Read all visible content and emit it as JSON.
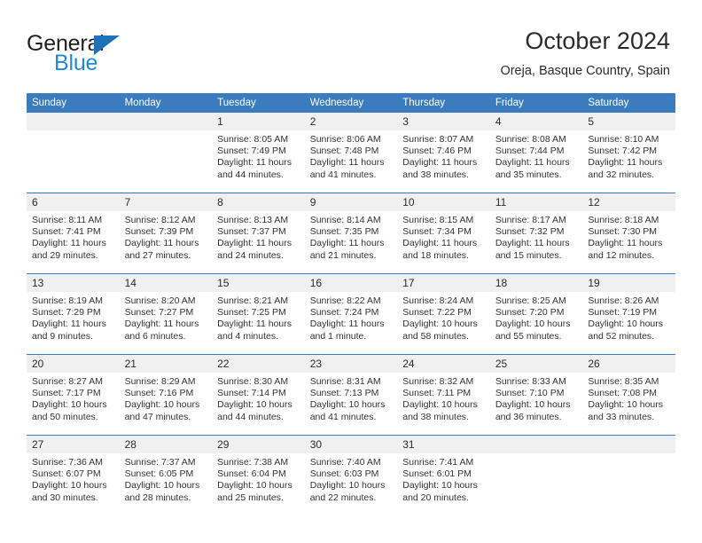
{
  "brand": {
    "name_part1": "General",
    "name_part2": "Blue",
    "triangle_color": "#1f72b8",
    "blue_color": "#1f8ad6"
  },
  "header": {
    "title": "October 2024",
    "subtitle": "Oreja, Basque Country, Spain"
  },
  "theme": {
    "header_blue": "#3a7cbe",
    "daynum_band": "#f0f0f0"
  },
  "weekdays": [
    "Sunday",
    "Monday",
    "Tuesday",
    "Wednesday",
    "Thursday",
    "Friday",
    "Saturday"
  ],
  "labels": {
    "sunrise_prefix": "Sunrise:",
    "sunset_prefix": "Sunset:",
    "daylight_prefix": "Daylight:"
  },
  "weeks": [
    [
      {
        "day": "",
        "sunrise": "",
        "sunset": "",
        "daylight": "",
        "blank": true
      },
      {
        "day": "",
        "sunrise": "",
        "sunset": "",
        "daylight": "",
        "blank": true
      },
      {
        "day": "1",
        "sunrise": "Sunrise: 8:05 AM",
        "sunset": "Sunset: 7:49 PM",
        "daylight": "Daylight: 11 hours and 44 minutes."
      },
      {
        "day": "2",
        "sunrise": "Sunrise: 8:06 AM",
        "sunset": "Sunset: 7:48 PM",
        "daylight": "Daylight: 11 hours and 41 minutes."
      },
      {
        "day": "3",
        "sunrise": "Sunrise: 8:07 AM",
        "sunset": "Sunset: 7:46 PM",
        "daylight": "Daylight: 11 hours and 38 minutes."
      },
      {
        "day": "4",
        "sunrise": "Sunrise: 8:08 AM",
        "sunset": "Sunset: 7:44 PM",
        "daylight": "Daylight: 11 hours and 35 minutes."
      },
      {
        "day": "5",
        "sunrise": "Sunrise: 8:10 AM",
        "sunset": "Sunset: 7:42 PM",
        "daylight": "Daylight: 11 hours and 32 minutes."
      }
    ],
    [
      {
        "day": "6",
        "sunrise": "Sunrise: 8:11 AM",
        "sunset": "Sunset: 7:41 PM",
        "daylight": "Daylight: 11 hours and 29 minutes."
      },
      {
        "day": "7",
        "sunrise": "Sunrise: 8:12 AM",
        "sunset": "Sunset: 7:39 PM",
        "daylight": "Daylight: 11 hours and 27 minutes."
      },
      {
        "day": "8",
        "sunrise": "Sunrise: 8:13 AM",
        "sunset": "Sunset: 7:37 PM",
        "daylight": "Daylight: 11 hours and 24 minutes."
      },
      {
        "day": "9",
        "sunrise": "Sunrise: 8:14 AM",
        "sunset": "Sunset: 7:35 PM",
        "daylight": "Daylight: 11 hours and 21 minutes."
      },
      {
        "day": "10",
        "sunrise": "Sunrise: 8:15 AM",
        "sunset": "Sunset: 7:34 PM",
        "daylight": "Daylight: 11 hours and 18 minutes."
      },
      {
        "day": "11",
        "sunrise": "Sunrise: 8:17 AM",
        "sunset": "Sunset: 7:32 PM",
        "daylight": "Daylight: 11 hours and 15 minutes."
      },
      {
        "day": "12",
        "sunrise": "Sunrise: 8:18 AM",
        "sunset": "Sunset: 7:30 PM",
        "daylight": "Daylight: 11 hours and 12 minutes."
      }
    ],
    [
      {
        "day": "13",
        "sunrise": "Sunrise: 8:19 AM",
        "sunset": "Sunset: 7:29 PM",
        "daylight": "Daylight: 11 hours and 9 minutes."
      },
      {
        "day": "14",
        "sunrise": "Sunrise: 8:20 AM",
        "sunset": "Sunset: 7:27 PM",
        "daylight": "Daylight: 11 hours and 6 minutes."
      },
      {
        "day": "15",
        "sunrise": "Sunrise: 8:21 AM",
        "sunset": "Sunset: 7:25 PM",
        "daylight": "Daylight: 11 hours and 4 minutes."
      },
      {
        "day": "16",
        "sunrise": "Sunrise: 8:22 AM",
        "sunset": "Sunset: 7:24 PM",
        "daylight": "Daylight: 11 hours and 1 minute."
      },
      {
        "day": "17",
        "sunrise": "Sunrise: 8:24 AM",
        "sunset": "Sunset: 7:22 PM",
        "daylight": "Daylight: 10 hours and 58 minutes."
      },
      {
        "day": "18",
        "sunrise": "Sunrise: 8:25 AM",
        "sunset": "Sunset: 7:20 PM",
        "daylight": "Daylight: 10 hours and 55 minutes."
      },
      {
        "day": "19",
        "sunrise": "Sunrise: 8:26 AM",
        "sunset": "Sunset: 7:19 PM",
        "daylight": "Daylight: 10 hours and 52 minutes."
      }
    ],
    [
      {
        "day": "20",
        "sunrise": "Sunrise: 8:27 AM",
        "sunset": "Sunset: 7:17 PM",
        "daylight": "Daylight: 10 hours and 50 minutes."
      },
      {
        "day": "21",
        "sunrise": "Sunrise: 8:29 AM",
        "sunset": "Sunset: 7:16 PM",
        "daylight": "Daylight: 10 hours and 47 minutes."
      },
      {
        "day": "22",
        "sunrise": "Sunrise: 8:30 AM",
        "sunset": "Sunset: 7:14 PM",
        "daylight": "Daylight: 10 hours and 44 minutes."
      },
      {
        "day": "23",
        "sunrise": "Sunrise: 8:31 AM",
        "sunset": "Sunset: 7:13 PM",
        "daylight": "Daylight: 10 hours and 41 minutes."
      },
      {
        "day": "24",
        "sunrise": "Sunrise: 8:32 AM",
        "sunset": "Sunset: 7:11 PM",
        "daylight": "Daylight: 10 hours and 38 minutes."
      },
      {
        "day": "25",
        "sunrise": "Sunrise: 8:33 AM",
        "sunset": "Sunset: 7:10 PM",
        "daylight": "Daylight: 10 hours and 36 minutes."
      },
      {
        "day": "26",
        "sunrise": "Sunrise: 8:35 AM",
        "sunset": "Sunset: 7:08 PM",
        "daylight": "Daylight: 10 hours and 33 minutes."
      }
    ],
    [
      {
        "day": "27",
        "sunrise": "Sunrise: 7:36 AM",
        "sunset": "Sunset: 6:07 PM",
        "daylight": "Daylight: 10 hours and 30 minutes."
      },
      {
        "day": "28",
        "sunrise": "Sunrise: 7:37 AM",
        "sunset": "Sunset: 6:05 PM",
        "daylight": "Daylight: 10 hours and 28 minutes."
      },
      {
        "day": "29",
        "sunrise": "Sunrise: 7:38 AM",
        "sunset": "Sunset: 6:04 PM",
        "daylight": "Daylight: 10 hours and 25 minutes."
      },
      {
        "day": "30",
        "sunrise": "Sunrise: 7:40 AM",
        "sunset": "Sunset: 6:03 PM",
        "daylight": "Daylight: 10 hours and 22 minutes."
      },
      {
        "day": "31",
        "sunrise": "Sunrise: 7:41 AM",
        "sunset": "Sunset: 6:01 PM",
        "daylight": "Daylight: 10 hours and 20 minutes."
      },
      {
        "day": "",
        "sunrise": "",
        "sunset": "",
        "daylight": "",
        "blank": true
      },
      {
        "day": "",
        "sunrise": "",
        "sunset": "",
        "daylight": "",
        "blank": true
      }
    ]
  ]
}
